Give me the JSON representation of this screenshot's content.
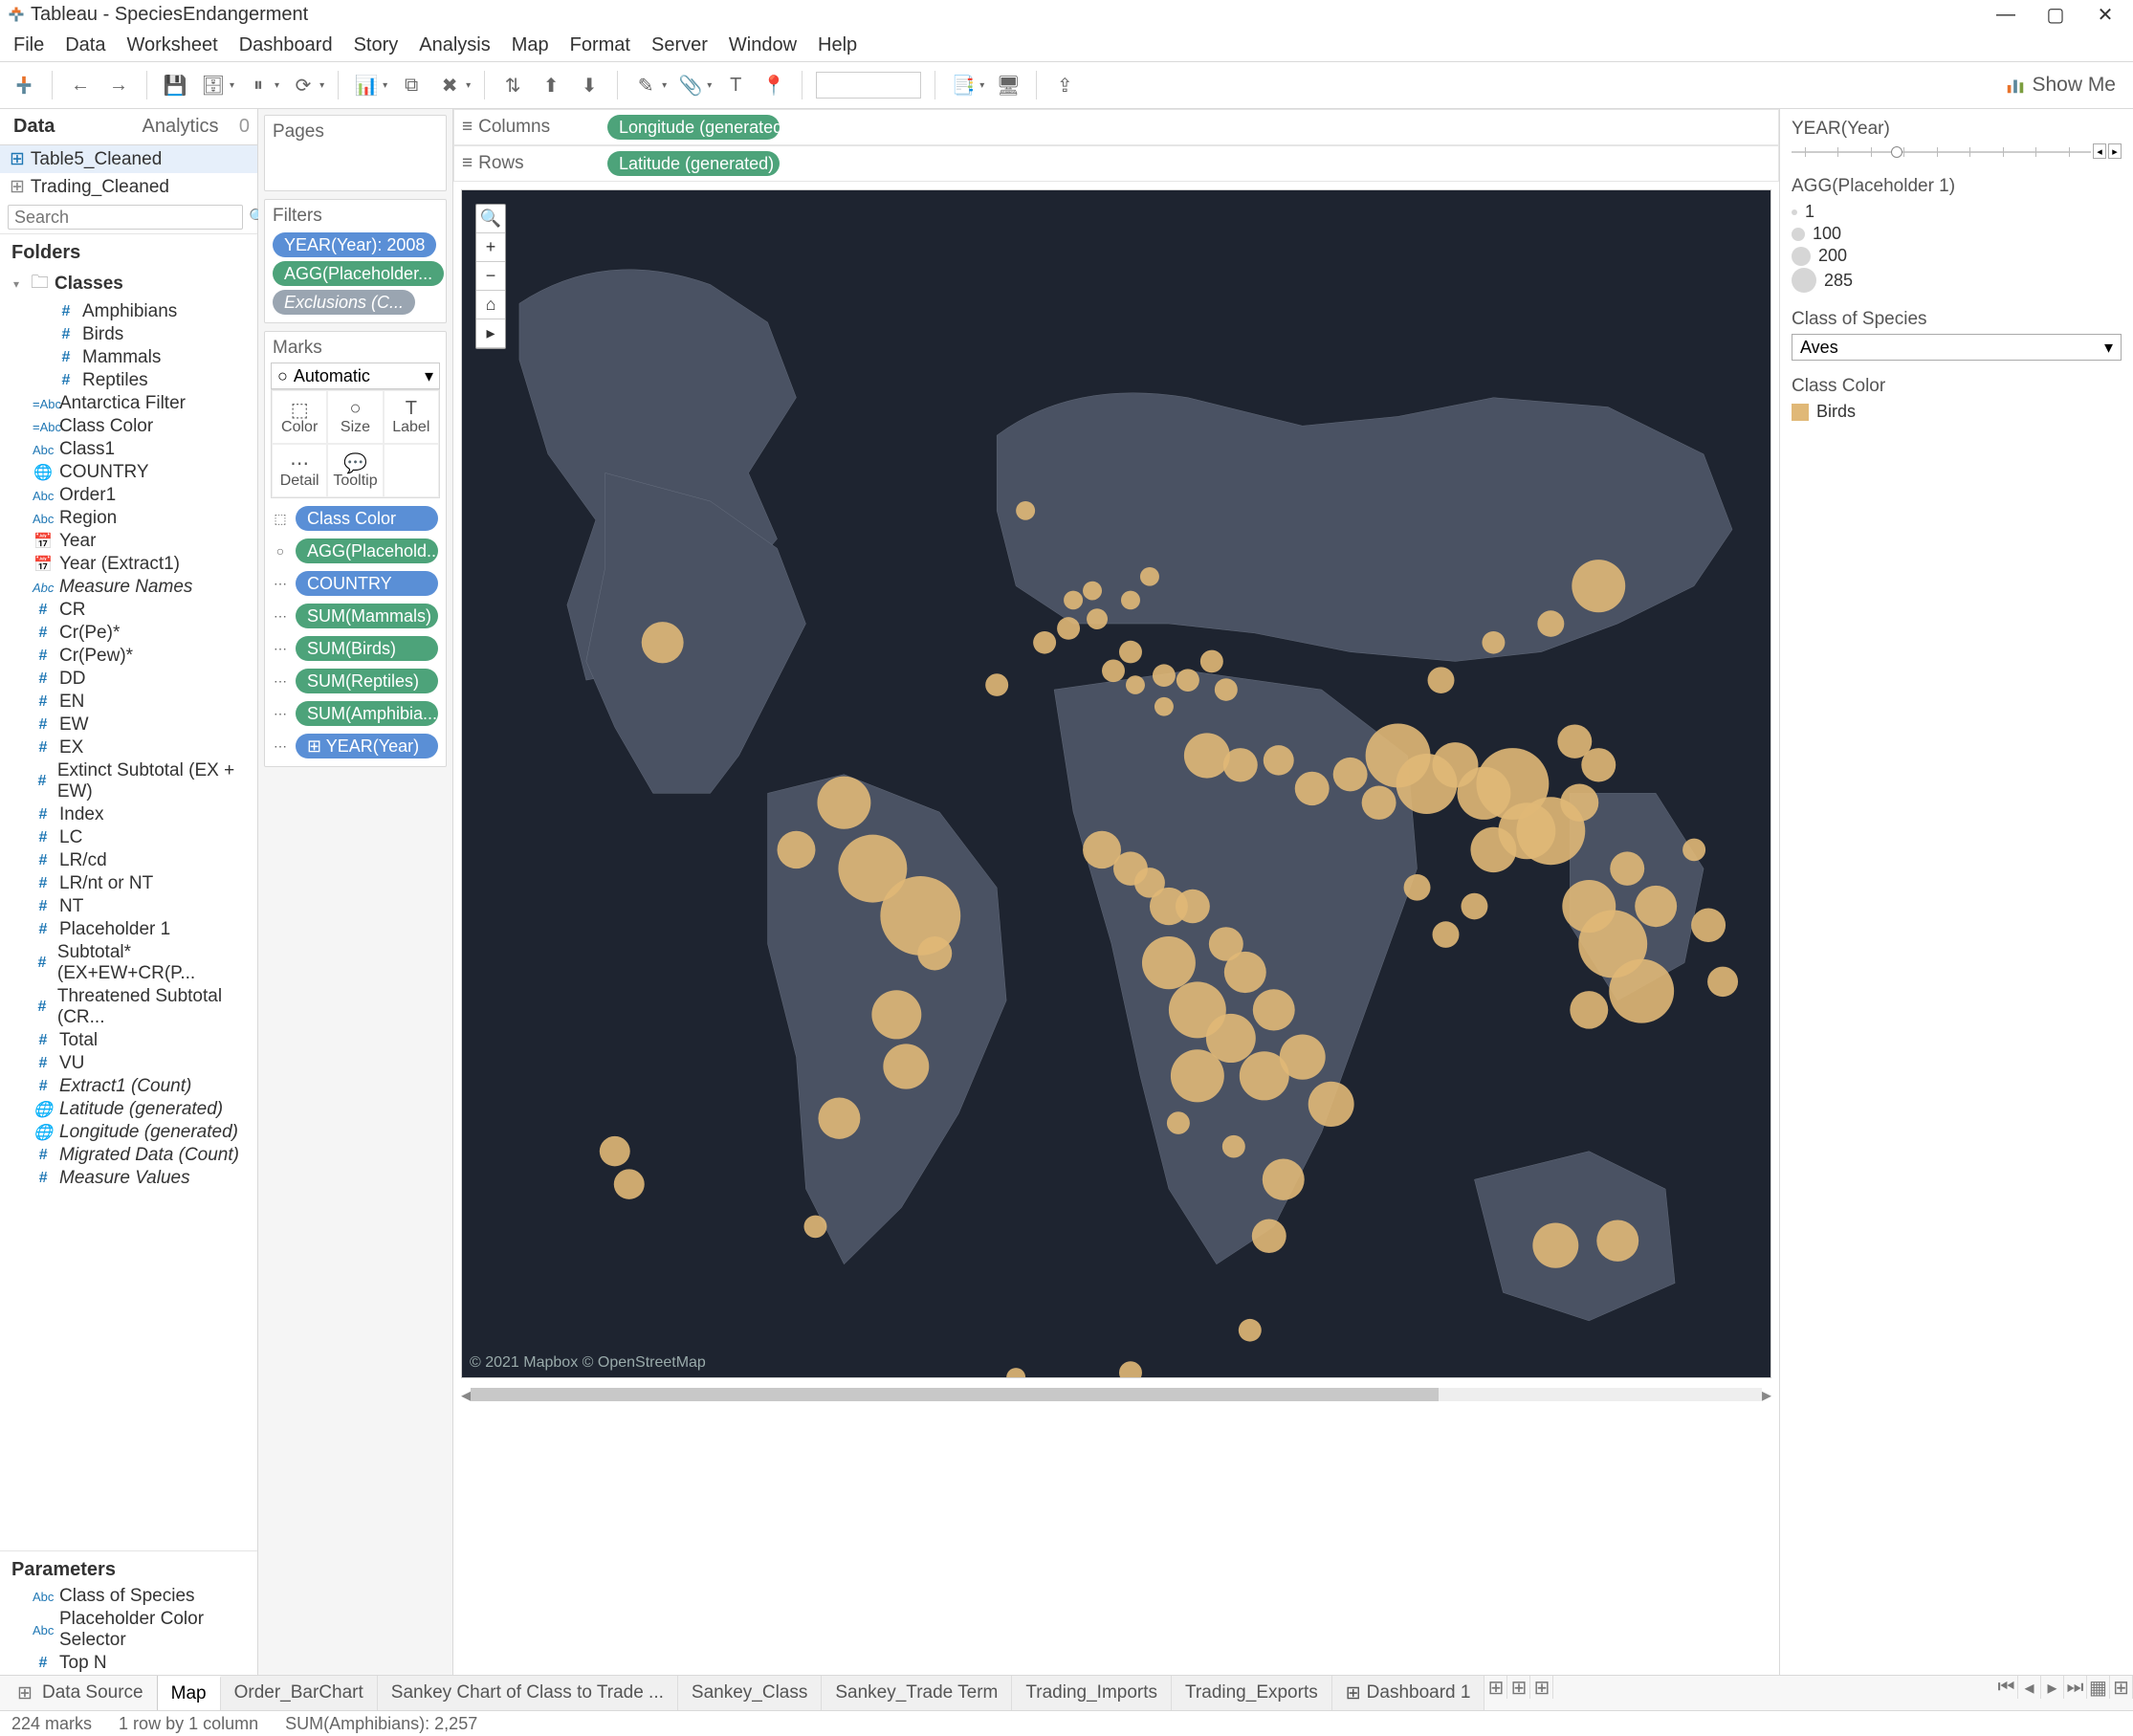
{
  "title_bar": {
    "app": "Tableau",
    "file": "SpeciesEndangerment"
  },
  "menu": [
    "File",
    "Data",
    "Worksheet",
    "Dashboard",
    "Story",
    "Analysis",
    "Map",
    "Format",
    "Server",
    "Window",
    "Help"
  ],
  "showme": "Show Me",
  "side_tabs": {
    "data": "Data",
    "analytics": "Analytics",
    "badge": "0"
  },
  "data_sources": {
    "a": "Table5_Cleaned",
    "b": "Trading_Cleaned"
  },
  "search_placeholder": "Search",
  "folders_header": "Folders",
  "folder_group": "Classes",
  "class_items": [
    "Amphibians",
    "Birds",
    "Mammals",
    "Reptiles"
  ],
  "fields": [
    {
      "ico": "abc",
      "txt": "Antarctica Filter",
      "pre": "=Abc"
    },
    {
      "ico": "abc",
      "txt": "Class Color",
      "pre": "=Abc"
    },
    {
      "ico": "abc",
      "txt": "Class1",
      "pre": "Abc"
    },
    {
      "ico": "glb",
      "txt": "COUNTRY"
    },
    {
      "ico": "abc",
      "txt": "Order1",
      "pre": "Abc"
    },
    {
      "ico": "abc",
      "txt": "Region",
      "pre": "Abc"
    },
    {
      "ico": "date",
      "txt": "Year"
    },
    {
      "ico": "date",
      "txt": "Year (Extract1)"
    },
    {
      "ico": "abc",
      "txt": "Measure Names",
      "italic": true,
      "pre": "Abc"
    },
    {
      "ico": "num",
      "txt": "CR"
    },
    {
      "ico": "num",
      "txt": "Cr(Pe)*"
    },
    {
      "ico": "num",
      "txt": "Cr(Pew)*"
    },
    {
      "ico": "num",
      "txt": "DD"
    },
    {
      "ico": "num",
      "txt": "EN"
    },
    {
      "ico": "num",
      "txt": "EW"
    },
    {
      "ico": "num",
      "txt": "EX"
    },
    {
      "ico": "num",
      "txt": "Extinct Subtotal (EX + EW)"
    },
    {
      "ico": "num",
      "txt": "Index"
    },
    {
      "ico": "num",
      "txt": "LC"
    },
    {
      "ico": "num",
      "txt": "LR/cd"
    },
    {
      "ico": "num",
      "txt": "LR/nt or NT"
    },
    {
      "ico": "num",
      "txt": "NT"
    },
    {
      "ico": "num",
      "txt": "Placeholder 1"
    },
    {
      "ico": "num",
      "txt": "Subtotal* (EX+EW+CR(P..."
    },
    {
      "ico": "num",
      "txt": "Threatened Subtotal (CR..."
    },
    {
      "ico": "num",
      "txt": "Total"
    },
    {
      "ico": "num",
      "txt": "VU"
    },
    {
      "ico": "num",
      "txt": "Extract1 (Count)",
      "italic": true
    },
    {
      "ico": "glb",
      "txt": "Latitude (generated)",
      "italic": true
    },
    {
      "ico": "glb",
      "txt": "Longitude (generated)",
      "italic": true
    },
    {
      "ico": "num",
      "txt": "Migrated Data (Count)",
      "italic": true
    },
    {
      "ico": "num",
      "txt": "Measure Values",
      "italic": true
    }
  ],
  "parameters_header": "Parameters",
  "parameters": [
    {
      "ico": "abc",
      "txt": "Class of Species",
      "pre": "Abc"
    },
    {
      "ico": "abc",
      "txt": "Placeholder Color Selector",
      "pre": "Abc"
    },
    {
      "ico": "num",
      "txt": "Top N"
    }
  ],
  "shelves": {
    "pages": "Pages",
    "filters": "Filters",
    "filter_pills": [
      "YEAR(Year): 2008",
      "AGG(Placeholder...",
      "Exclusions (C..."
    ],
    "marks": "Marks",
    "mark_type": "Automatic",
    "mark_btns": [
      "Color",
      "Size",
      "Label",
      "Detail",
      "Tooltip"
    ],
    "mark_pills": [
      {
        "c": "blue",
        "t": "Class Color"
      },
      {
        "c": "green",
        "t": "AGG(Placehold..."
      },
      {
        "c": "blue",
        "t": "COUNTRY"
      },
      {
        "c": "green",
        "t": "SUM(Mammals)"
      },
      {
        "c": "green",
        "t": "SUM(Birds)"
      },
      {
        "c": "green",
        "t": "SUM(Reptiles)"
      },
      {
        "c": "green",
        "t": "SUM(Amphibia..."
      },
      {
        "c": "blue",
        "t": "⊞ YEAR(Year)"
      }
    ],
    "columns_label": "Columns",
    "columns_pill": "Longitude (generated)",
    "rows_label": "Rows",
    "rows_pill": "Latitude (generated)"
  },
  "map_attr": "© 2021 Mapbox © OpenStreetMap",
  "right": {
    "year_h": "YEAR(Year)",
    "agg_h": "AGG(Placeholder 1)",
    "size_legend": [
      {
        "s": 6,
        "v": "1"
      },
      {
        "s": 14,
        "v": "100"
      },
      {
        "s": 20,
        "v": "200"
      },
      {
        "s": 26,
        "v": "285"
      }
    ],
    "class_h": "Class of Species",
    "class_sel": "Aves",
    "color_h": "Class Color",
    "color_item": "Birds"
  },
  "bottom_tabs": {
    "ds": "Data Source",
    "tabs": [
      "Map",
      "Order_BarChart",
      "Sankey Chart of Class to Trade ...",
      "Sankey_Class",
      "Sankey_Trade Term",
      "Trading_Imports",
      "Trading_Exports",
      "Dashboard 1"
    ],
    "active": "Map"
  },
  "status": {
    "a": "224 marks",
    "b": "1 row by 1 column",
    "c": "SUM(Amphibians): 2,257"
  },
  "bubbles": [
    [
      210,
      480,
      22
    ],
    [
      350,
      700,
      20
    ],
    [
      400,
      650,
      28
    ],
    [
      430,
      720,
      36
    ],
    [
      480,
      770,
      42
    ],
    [
      495,
      810,
      18
    ],
    [
      455,
      875,
      26
    ],
    [
      465,
      930,
      24
    ],
    [
      395,
      985,
      22
    ],
    [
      370,
      1100,
      12
    ],
    [
      160,
      1020,
      16
    ],
    [
      175,
      1055,
      16
    ],
    [
      560,
      525,
      12
    ],
    [
      590,
      340,
      10
    ],
    [
      610,
      480,
      12
    ],
    [
      635,
      465,
      12
    ],
    [
      640,
      435,
      10
    ],
    [
      660,
      425,
      10
    ],
    [
      665,
      455,
      11
    ],
    [
      700,
      435,
      10
    ],
    [
      720,
      410,
      10
    ],
    [
      700,
      490,
      12
    ],
    [
      682,
      510,
      12
    ],
    [
      705,
      525,
      10
    ],
    [
      735,
      515,
      12
    ],
    [
      735,
      548,
      10
    ],
    [
      760,
      520,
      12
    ],
    [
      785,
      500,
      12
    ],
    [
      800,
      530,
      12
    ],
    [
      670,
      700,
      20
    ],
    [
      700,
      720,
      18
    ],
    [
      720,
      735,
      16
    ],
    [
      740,
      760,
      20
    ],
    [
      765,
      760,
      18
    ],
    [
      800,
      800,
      18
    ],
    [
      820,
      830,
      22
    ],
    [
      850,
      870,
      22
    ],
    [
      880,
      920,
      24
    ],
    [
      910,
      970,
      24
    ],
    [
      860,
      1050,
      22
    ],
    [
      845,
      1110,
      18
    ],
    [
      740,
      820,
      28
    ],
    [
      770,
      870,
      30
    ],
    [
      805,
      900,
      26
    ],
    [
      840,
      940,
      26
    ],
    [
      770,
      940,
      28
    ],
    [
      750,
      990,
      12
    ],
    [
      808,
      1015,
      12
    ],
    [
      700,
      1255,
      12
    ],
    [
      825,
      1210,
      12
    ],
    [
      780,
      600,
      24
    ],
    [
      815,
      610,
      18
    ],
    [
      855,
      605,
      16
    ],
    [
      890,
      635,
      18
    ],
    [
      930,
      620,
      18
    ],
    [
      960,
      650,
      18
    ],
    [
      980,
      600,
      34
    ],
    [
      1010,
      630,
      32
    ],
    [
      1040,
      610,
      24
    ],
    [
      1070,
      640,
      28
    ],
    [
      1100,
      630,
      38
    ],
    [
      1115,
      680,
      30
    ],
    [
      1080,
      700,
      24
    ],
    [
      1140,
      680,
      36
    ],
    [
      1170,
      650,
      20
    ],
    [
      1190,
      610,
      18
    ],
    [
      1165,
      585,
      18
    ],
    [
      1220,
      720,
      18
    ],
    [
      1250,
      760,
      22
    ],
    [
      1180,
      760,
      28
    ],
    [
      1205,
      800,
      36
    ],
    [
      1235,
      850,
      34
    ],
    [
      1180,
      870,
      20
    ],
    [
      1290,
      700,
      12
    ],
    [
      1305,
      780,
      18
    ],
    [
      1320,
      840,
      16
    ],
    [
      1145,
      1120,
      24
    ],
    [
      1210,
      1115,
      22
    ],
    [
      1190,
      420,
      28
    ],
    [
      1140,
      460,
      14
    ],
    [
      1080,
      480,
      12
    ],
    [
      1025,
      520,
      14
    ],
    [
      580,
      1260,
      10
    ],
    [
      1030,
      790,
      14
    ],
    [
      1060,
      760,
      14
    ],
    [
      1000,
      740,
      14
    ]
  ]
}
